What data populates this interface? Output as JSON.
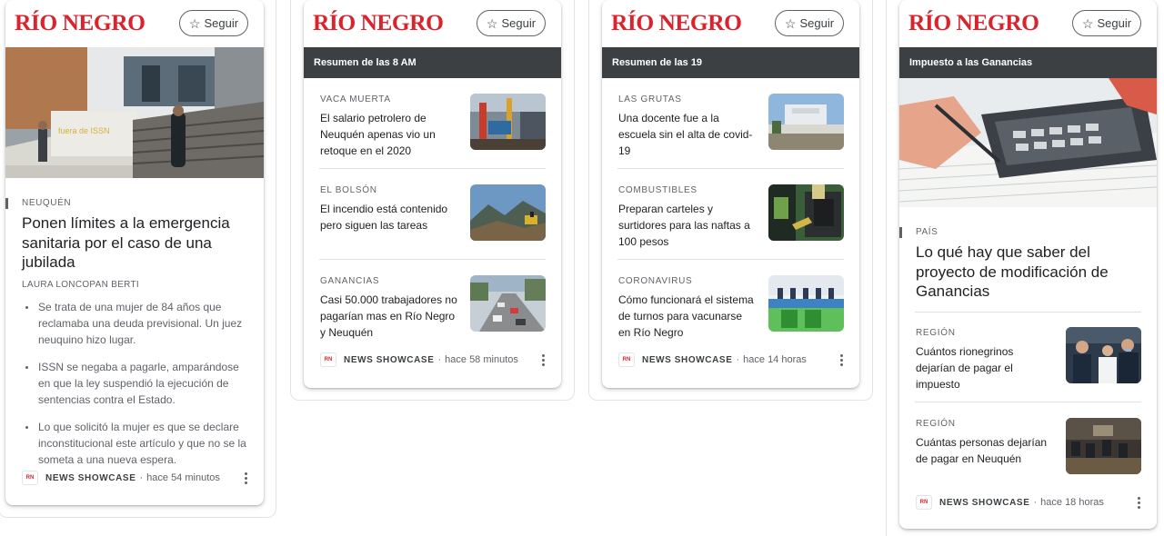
{
  "brand": {
    "logo_text": "RÍO NEGRO",
    "accent": "#d9232d",
    "follow_label": "Seguir",
    "follow_icon": "star-outline-icon"
  },
  "cards": [
    {
      "lead": {
        "kicker": "NEUQUÉN",
        "title": "Ponen límites a la emergencia sanitaria por el caso de una jubilada",
        "byline": "LAURA LONCOPAN BERTI",
        "bullets": [
          "Se trata de una mujer de 84 años que reclamaba una deuda previsional. Un juez neuquino hizo lugar.",
          "ISSN se negaba a pagarle, amparándose en que la ley suspendió la ejecución de sentencias contra el Estado.",
          "Lo que solicitó la mujer es que se declare inconstitucional este artículo y que no se la someta a una nueva espera."
        ]
      },
      "footer": {
        "badge": "RN",
        "source": "NEWS SHOWCASE",
        "sep": "·",
        "time": "hace 54 minutos"
      }
    },
    {
      "bar": "Resumen de las 8 AM",
      "items": [
        {
          "kicker": "VACA MUERTA",
          "title": "El salario petrolero de Neuquén apenas vio un retoque en el 2020"
        },
        {
          "kicker": "EL BOLSÓN",
          "title": "El incendio está contenido pero siguen las tareas"
        },
        {
          "kicker": "GANANCIAS",
          "title": "Casi 50.000 trabajadores no pagarían mas en Río Negro y Neuquén"
        }
      ],
      "footer": {
        "badge": "RN",
        "source": "NEWS SHOWCASE",
        "sep": "·",
        "time": "hace 58 minutos"
      }
    },
    {
      "bar": "Resumen de las 19",
      "items": [
        {
          "kicker": "LAS GRUTAS",
          "title": "Una docente fue a la escuela sin el alta de covid-19"
        },
        {
          "kicker": "COMBUSTIBLES",
          "title": "Preparan carteles y surtidores para las naftas a 100 pesos"
        },
        {
          "kicker": "CORONAVIRUS",
          "title": "Cómo funcionará el sistema de turnos para vacunarse en Río Negro"
        }
      ],
      "footer": {
        "badge": "RN",
        "source": "NEWS SHOWCASE",
        "sep": "·",
        "time": "hace 14 horas"
      }
    },
    {
      "bar": "Impuesto a las Ganancias",
      "lead": {
        "kicker": "PAÍS",
        "title": "Lo qué hay que saber del proyecto de modificación de Ganancias"
      },
      "items": [
        {
          "kicker": "REGIÓN",
          "title": "Cuántos rionegrinos dejarían de pagar el impuesto"
        },
        {
          "kicker": "REGIÓN",
          "title": "Cuántas personas dejarían de pagar en Neuquén"
        }
      ],
      "footer": {
        "badge": "RN",
        "source": "NEWS SHOWCASE",
        "sep": "·",
        "time": "hace 18 horas"
      }
    }
  ]
}
